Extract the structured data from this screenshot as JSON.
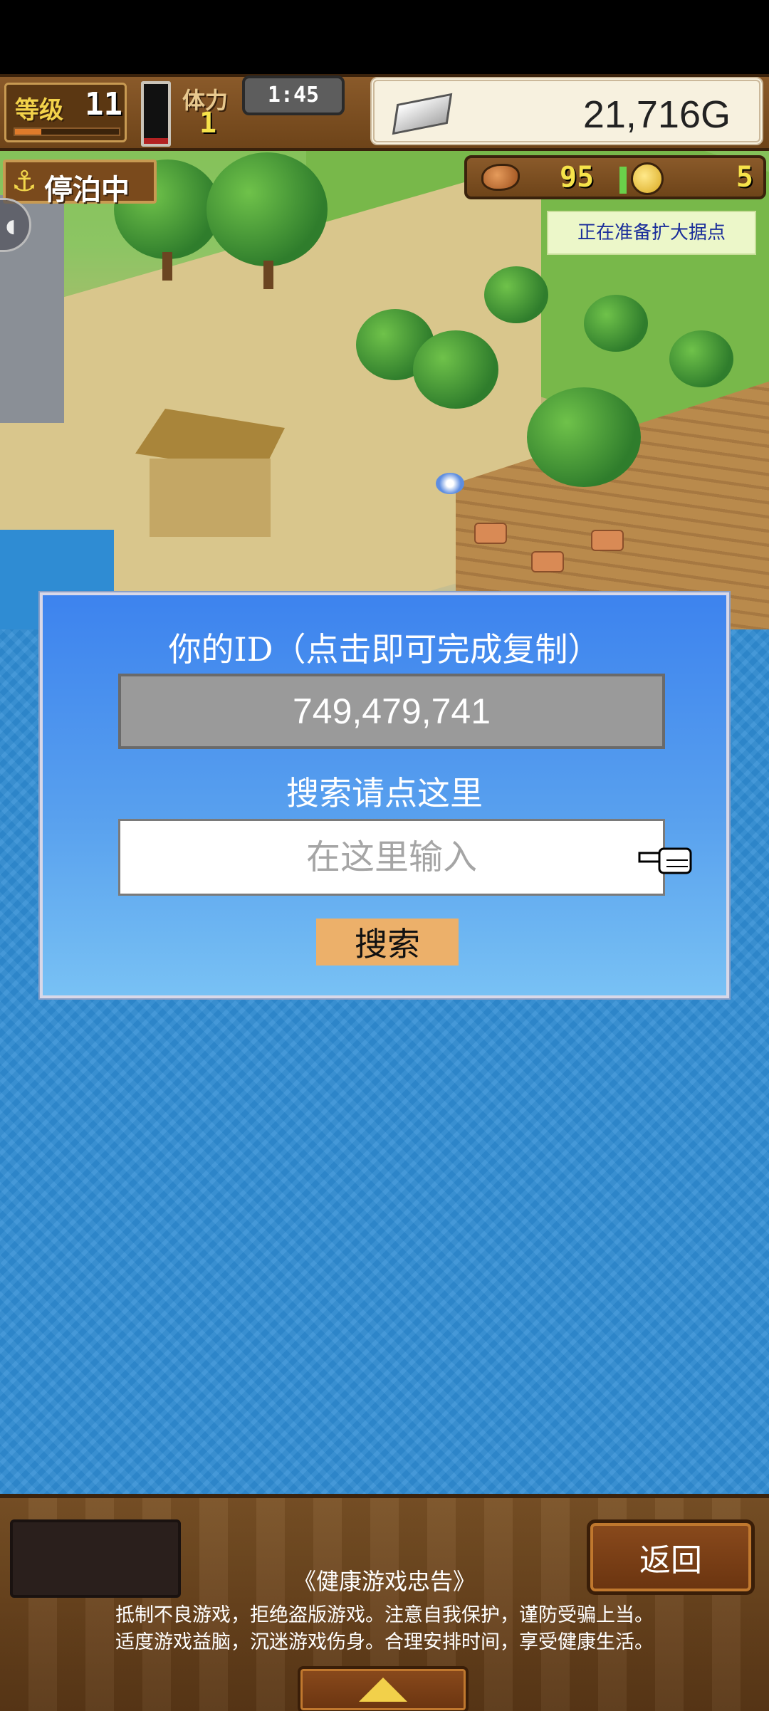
{
  "hud": {
    "level_label": "等级",
    "level_value": "11",
    "exp_fraction": 0.25,
    "stamina_label": "体力",
    "stamina_value": "1",
    "stamina_gauge_fraction": 0.1,
    "timer": "1:45",
    "money": "21,716G",
    "docked_label": "停泊中",
    "food_value": "95",
    "coin_value": "5",
    "notice": "正在准备扩大据点"
  },
  "dialog": {
    "title": "你的ID（点击即可完成复制）",
    "user_id": "749,479,741",
    "search_title": "搜索请点这里",
    "search_placeholder": "在这里输入",
    "search_button": "搜索"
  },
  "footer": {
    "back_button": "返回",
    "health_title": "《健康游戏忠告》",
    "health_line_1": "抵制不良游戏，拒绝盗版游戏。注意自我保护，谨防受骗上当。",
    "health_line_2": "适度游戏益脑，沉迷游戏伤身。合理安排时间，享受健康生活。"
  },
  "icons": {
    "anchor": "anchor-icon",
    "silver": "silver-ingot-icon",
    "food": "food-icon",
    "coin": "coin-icon",
    "hand": "pointing-hand-icon",
    "expand": "up-arrow-icon"
  },
  "colors": {
    "dialog_blue": "#3d83ee",
    "search_button": "#ecb06a",
    "notice_text": "#1a2d9a",
    "panel_brown": "#7b5226"
  }
}
